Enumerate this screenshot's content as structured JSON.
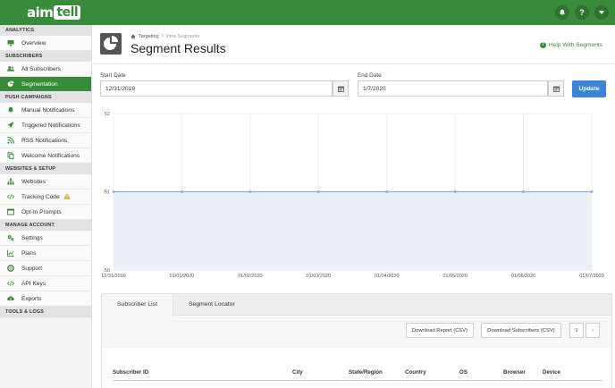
{
  "app": {
    "logo_text": "aim",
    "logo_box": "tell",
    "notifications_icon": "bell-icon",
    "help_icon": "question-icon",
    "account_icon": "caret-down-icon"
  },
  "sidebar": {
    "sections": [
      {
        "title": "ANALYTICS",
        "items": [
          {
            "label": "Overview",
            "icon": "monitor-icon"
          }
        ]
      },
      {
        "title": "SUBSCRIBERS",
        "items": [
          {
            "label": "All Subscribers",
            "icon": "users-icon"
          },
          {
            "label": "Segmentation",
            "icon": "pie-icon",
            "active": true
          }
        ]
      },
      {
        "title": "PUSH CAMPAIGNS",
        "items": [
          {
            "label": "Manual Notifications",
            "icon": "bell-icon"
          },
          {
            "label": "Triggered Notifications",
            "icon": "send-icon"
          },
          {
            "label": "RSS Notifications",
            "icon": "rss-icon"
          },
          {
            "label": "Welcome Notifications",
            "icon": "copy-icon"
          }
        ]
      },
      {
        "title": "WEBSITES & SETUP",
        "items": [
          {
            "label": "Websites",
            "icon": "sitemap-icon"
          },
          {
            "label": "Tracking Code",
            "icon": "code-icon",
            "warning": true
          },
          {
            "label": "Opt-In Prompts",
            "icon": "window-icon"
          }
        ]
      },
      {
        "title": "MANAGE ACCOUNT",
        "items": [
          {
            "label": "Settings",
            "icon": "gears-icon"
          },
          {
            "label": "Plans",
            "icon": "chart-icon"
          },
          {
            "label": "Support",
            "icon": "lifebuoy-icon"
          },
          {
            "label": "API Keys",
            "icon": "code-icon"
          },
          {
            "label": "Exports",
            "icon": "cloud-download-icon"
          }
        ]
      },
      {
        "title": "TOOLS & LOGS",
        "items": []
      }
    ]
  },
  "header": {
    "breadcrumb": [
      "Targeting",
      "View Segments"
    ],
    "title": "Segment Results",
    "help_label": "Help With Segments"
  },
  "filters": {
    "start_label": "Start Date",
    "start_value": "12/31/2019",
    "end_label": "End Date",
    "end_value": "1/7/2020",
    "update_label": "Update"
  },
  "chart_data": {
    "type": "area",
    "x": [
      "12/31/2019",
      "01/01/2020",
      "01/02/2020",
      "01/03/2020",
      "01/04/2020",
      "01/05/2020",
      "01/06/2020",
      "01/07/2020"
    ],
    "values": [
      51,
      51,
      51,
      51,
      51,
      51,
      51,
      51
    ],
    "ylim": [
      50,
      52
    ],
    "yticks": [
      50,
      51,
      52
    ],
    "grid": true,
    "line_color": "#8fb1d6",
    "fill_color": "#e8f0f6"
  },
  "tabs": [
    {
      "label": "Subscriber List",
      "active": true
    },
    {
      "label": "Segment Locator",
      "active": false
    }
  ],
  "actions": {
    "download_report": "Download Report (CSV)",
    "download_subscribers": "Download Subscribers (CSV)",
    "page": "1",
    "next": "›"
  },
  "table": {
    "columns": [
      "Subscriber ID",
      "City",
      "State/Region",
      "Country",
      "OS",
      "Browser",
      "Device"
    ]
  }
}
